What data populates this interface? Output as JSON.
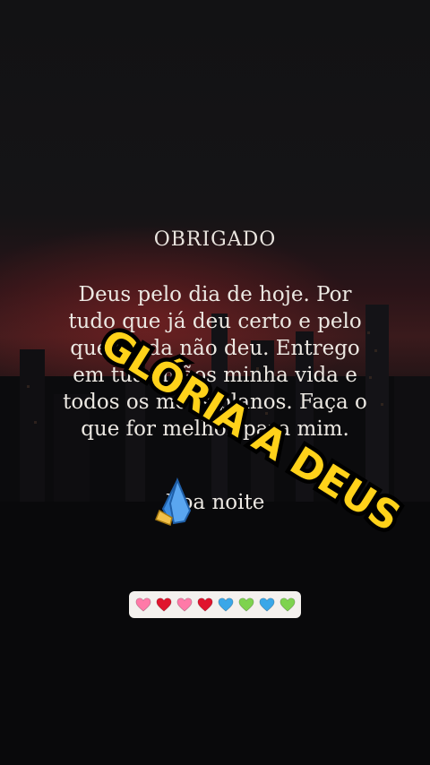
{
  "title": "OBRIGADO",
  "body_text": "Deus pelo dia de hoje. Por tudo que já deu certo e pelo que ainda não deu. Entrego em tuas mãos minha vida e todos os meus planos. Faça o que for melhor para mim.",
  "night_text": "Boa noite",
  "sticker_text": "GLÓRIA A DEUS",
  "pray_icon": "praying-hands-icon",
  "hearts": [
    {
      "name": "pink-heart-icon",
      "color": "#ff7aa8"
    },
    {
      "name": "red-heart-icon",
      "color": "#e0142d"
    },
    {
      "name": "pink-heart-icon",
      "color": "#ff7aa8"
    },
    {
      "name": "red-heart-icon",
      "color": "#e0142d"
    },
    {
      "name": "blue-heart-icon",
      "color": "#3aa7e8"
    },
    {
      "name": "green-heart-icon",
      "color": "#7ed34f"
    },
    {
      "name": "blue-heart-icon",
      "color": "#3aa7e8"
    },
    {
      "name": "green-heart-icon",
      "color": "#7ed34f"
    }
  ],
  "colors": {
    "sticker_fill": "#ffd21a",
    "sticker_outline": "#000000",
    "text": "#ece8e2"
  }
}
